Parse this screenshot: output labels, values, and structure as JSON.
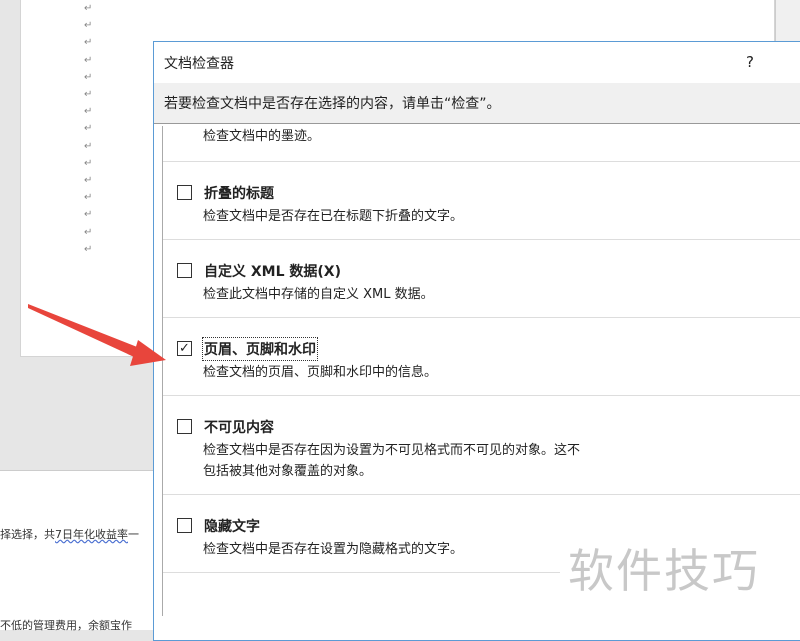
{
  "document": {
    "paragraph_mark": "↵",
    "lines": [
      {
        "text": "择选择，共",
        "underlined": "7日年化收益率",
        "tail": "一"
      },
      {
        "text": "不低的管理费用，余额宝作"
      }
    ]
  },
  "dialog": {
    "title": "文档检查器",
    "help": "?",
    "message": "若要检查文档中是否存在选择的内容，请单击“检查”。",
    "top_partial_desc": "检查文档中的墨迹。",
    "items": [
      {
        "label": "折叠的标题",
        "desc": "检查文档中是否存在已在标题下折叠的文字。",
        "checked": false
      },
      {
        "label": "自定义 XML 数据(X)",
        "desc": "检查此文档中存储的自定义 XML 数据。",
        "checked": false
      },
      {
        "label": "页眉、页脚和水印",
        "desc": "检查文档的页眉、页脚和水印中的信息。",
        "checked": true
      },
      {
        "label": "不可见内容",
        "desc": "检查文档中是否存在因为设置为不可见格式而不可见的对象。这不包括被其他对象覆盖的对象。",
        "checked": false
      },
      {
        "label": "隐藏文字",
        "desc": "检查文档中是否存在设置为隐藏格式的文字。",
        "checked": false
      }
    ]
  },
  "watermark": "软件技巧",
  "colors": {
    "arrow": "#e8453c",
    "dialog_border": "#5b9bd5"
  }
}
